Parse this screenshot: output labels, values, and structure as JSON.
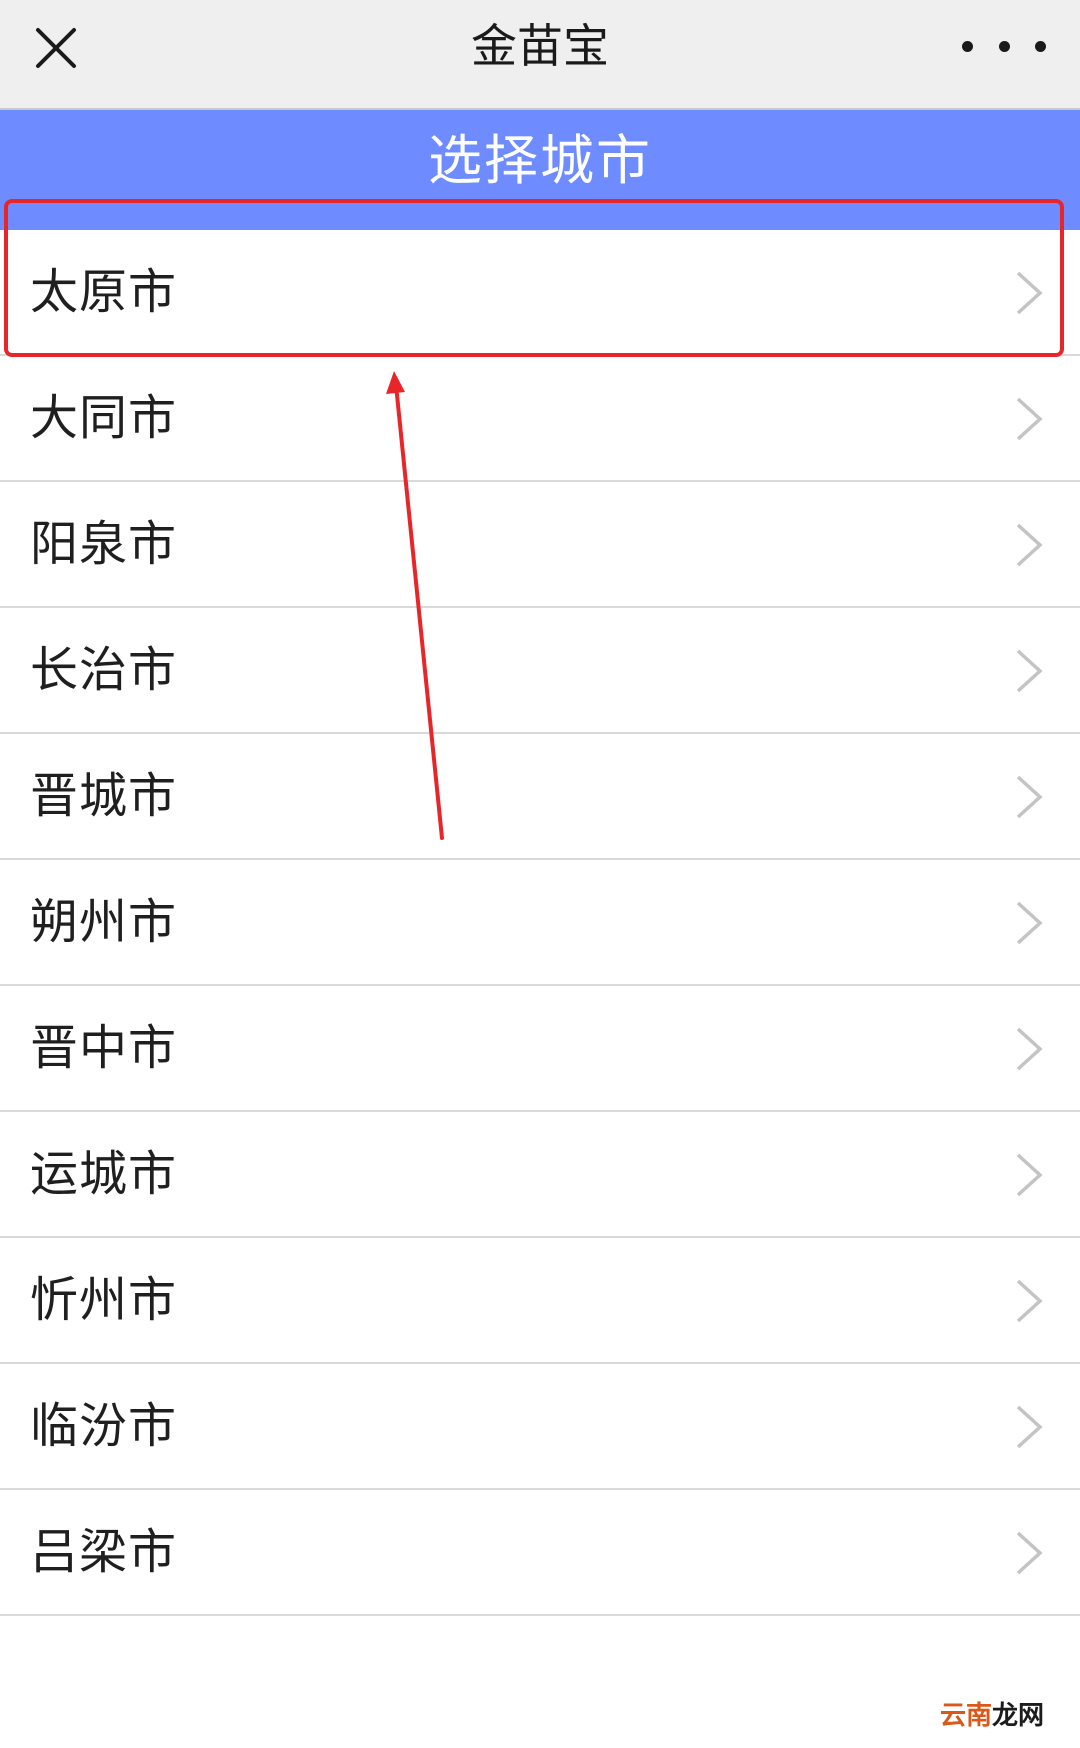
{
  "navbar": {
    "title": "金苗宝",
    "close_icon": "close-icon",
    "more_icon": "more-dots-icon"
  },
  "header": {
    "title": "选择城市",
    "background_color": "#6e8cff"
  },
  "cities": [
    {
      "name": "太原市"
    },
    {
      "name": "大同市"
    },
    {
      "name": "阳泉市"
    },
    {
      "name": "长治市"
    },
    {
      "name": "晋城市"
    },
    {
      "name": "朔州市"
    },
    {
      "name": "晋中市"
    },
    {
      "name": "运城市"
    },
    {
      "name": "忻州市"
    },
    {
      "name": "临汾市"
    },
    {
      "name": "吕梁市"
    }
  ],
  "annotation": {
    "highlight_color": "#e8262a",
    "highlighted_item": "太原市"
  },
  "watermark": {
    "part1": "云南",
    "part2": "龙网"
  }
}
